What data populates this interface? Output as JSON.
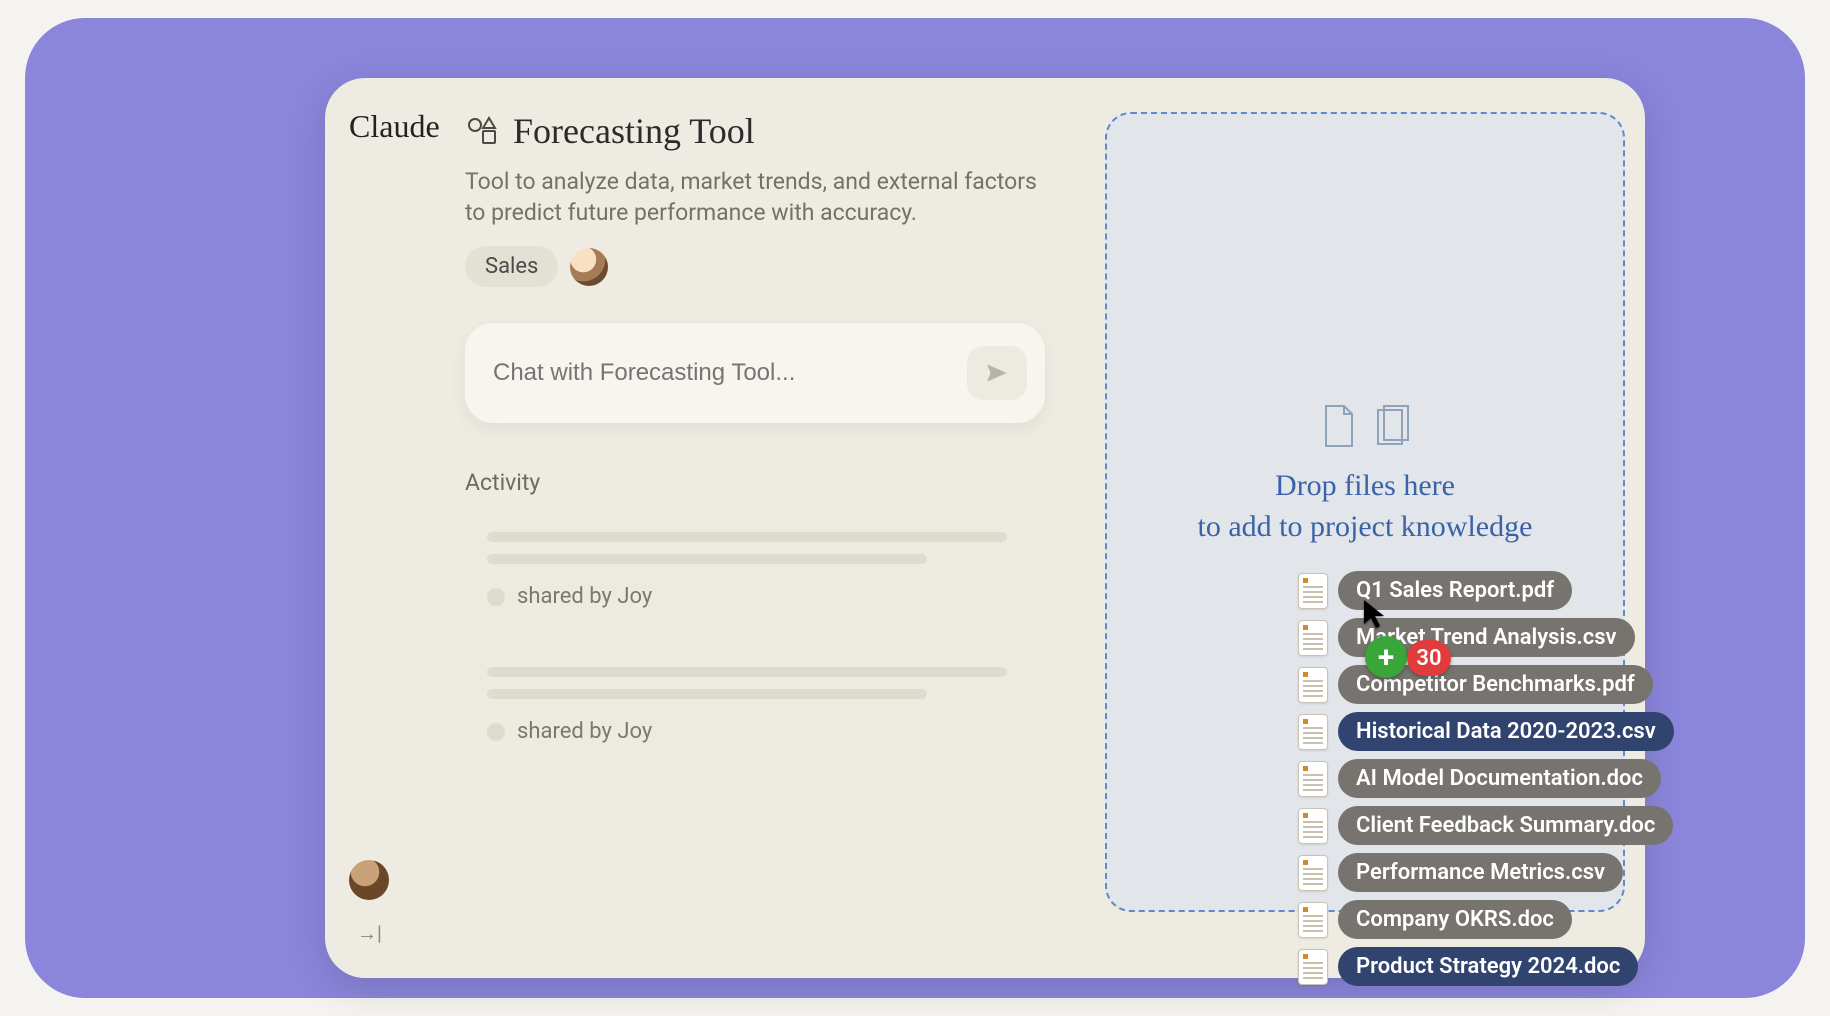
{
  "brand": "Claude",
  "project": {
    "title": "Forecasting Tool",
    "description": "Tool to analyze data, market trends, and external factors to predict future performance with accuracy.",
    "tag": "Sales"
  },
  "chat": {
    "placeholder": "Chat with Forecasting Tool..."
  },
  "activity": {
    "heading": "Activity",
    "items": [
      {
        "shared_by": "shared by Joy"
      },
      {
        "shared_by": "shared by Joy"
      }
    ]
  },
  "drop": {
    "line1": "Drop files here",
    "line2": "to add to project knowledge",
    "drag_count": "30"
  },
  "files": [
    {
      "name": "Q1 Sales Report.pdf",
      "style": "gray"
    },
    {
      "name": "Market Trend Analysis.csv",
      "style": "gray"
    },
    {
      "name": "Competitor Benchmarks.pdf",
      "style": "gray"
    },
    {
      "name": "Historical Data 2020-2023.csv",
      "style": "navy"
    },
    {
      "name": "AI Model Documentation.doc",
      "style": "gray"
    },
    {
      "name": "Client Feedback Summary.doc",
      "style": "gray"
    },
    {
      "name": "Performance Metrics.csv",
      "style": "gray"
    },
    {
      "name": "Company OKRS.doc",
      "style": "gray"
    },
    {
      "name": "Product Strategy 2024.doc",
      "style": "navy"
    }
  ]
}
